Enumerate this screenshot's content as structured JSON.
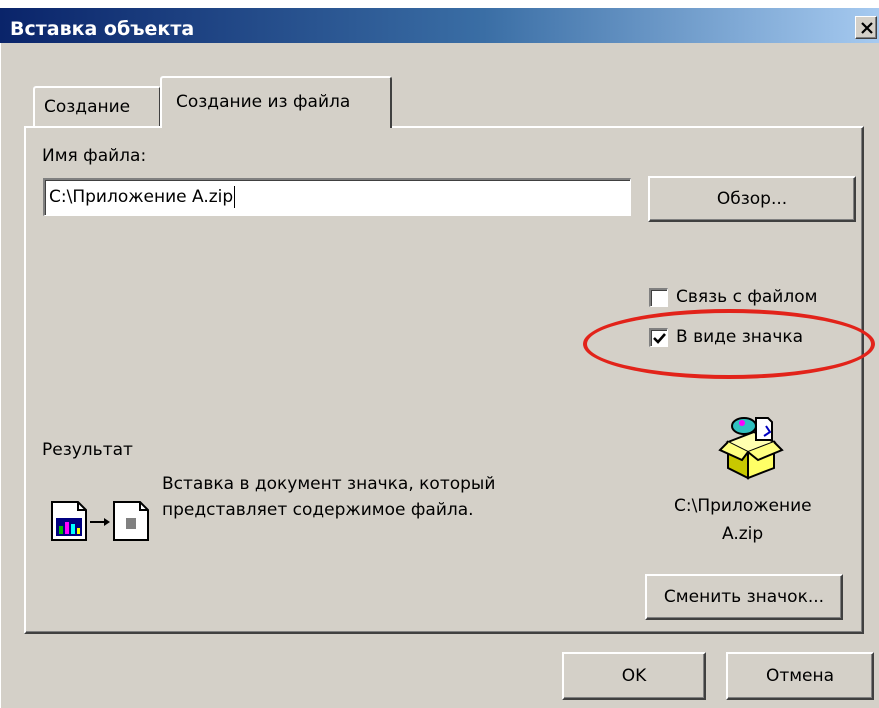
{
  "window": {
    "title": "Вставка объекта"
  },
  "tabs": [
    {
      "label": "Создание",
      "active": false
    },
    {
      "label": "Создание из файла",
      "active": true
    }
  ],
  "file": {
    "label": "Имя файла:",
    "value": "C:\\Приложение A.zip",
    "browse_label": "Обзор..."
  },
  "options": {
    "link_label": "Связь с файлом",
    "link_checked": false,
    "as_icon_label": "В виде значка",
    "as_icon_checked": true
  },
  "result": {
    "heading": "Результат",
    "description_line1": "Вставка в документ значка, который",
    "description_line2": "представляет содержимое файла."
  },
  "icon_preview": {
    "caption_line1": "C:\\Приложение",
    "caption_line2": "A.zip",
    "change_icon_label": "Сменить значок..."
  },
  "buttons": {
    "ok_label": "OK",
    "cancel_label": "Отмена"
  },
  "colors": {
    "titlebar_start": "#0a246a",
    "titlebar_end": "#a6caf0",
    "dialog_face": "#d4d0c8",
    "highlight_ellipse": "#e2231a"
  }
}
